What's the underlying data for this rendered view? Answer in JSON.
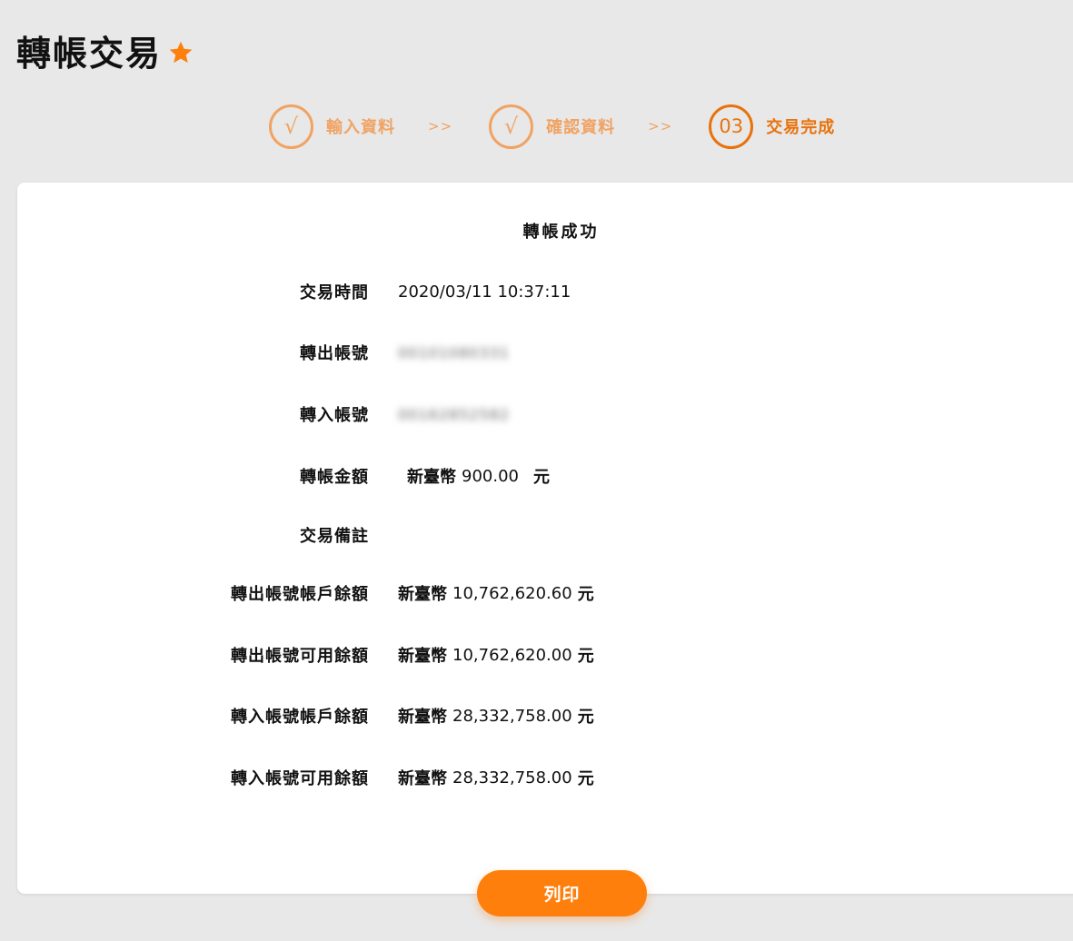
{
  "header": {
    "title": "轉帳交易",
    "favorite_icon": "star-icon",
    "accent_color": "#fe7f0c"
  },
  "steps": [
    {
      "marker": "√",
      "label": "輸入資料",
      "status": "done"
    },
    {
      "marker": "√",
      "label": "確認資料",
      "status": "done"
    },
    {
      "marker": "03",
      "label": "交易完成",
      "status": "current"
    }
  ],
  "step_separator": ">>",
  "result": {
    "heading": "轉帳成功",
    "rows": [
      {
        "label": "交易時間",
        "value": "2020/03/11 10:37:11"
      },
      {
        "label": "轉出帳號",
        "value": "00101080331"
      },
      {
        "label": "轉入帳號",
        "value": "00162852582"
      },
      {
        "label": "轉帳金額",
        "currency": "新臺幣",
        "amount": "900.00",
        "unit": "元"
      },
      {
        "label": "交易備註",
        "value": ""
      },
      {
        "label": "轉出帳號帳戶餘額",
        "currency": "新臺幣",
        "amount": "10,762,620.60",
        "unit": "元"
      },
      {
        "label": "轉出帳號可用餘額",
        "currency": "新臺幣",
        "amount": "10,762,620.00",
        "unit": "元"
      },
      {
        "label": "轉入帳號帳戶餘額",
        "currency": "新臺幣",
        "amount": "28,332,758.00",
        "unit": "元"
      },
      {
        "label": "轉入帳號可用餘額",
        "currency": "新臺幣",
        "amount": "28,332,758.00",
        "unit": "元"
      }
    ]
  },
  "actions": {
    "print_label": "列印"
  }
}
